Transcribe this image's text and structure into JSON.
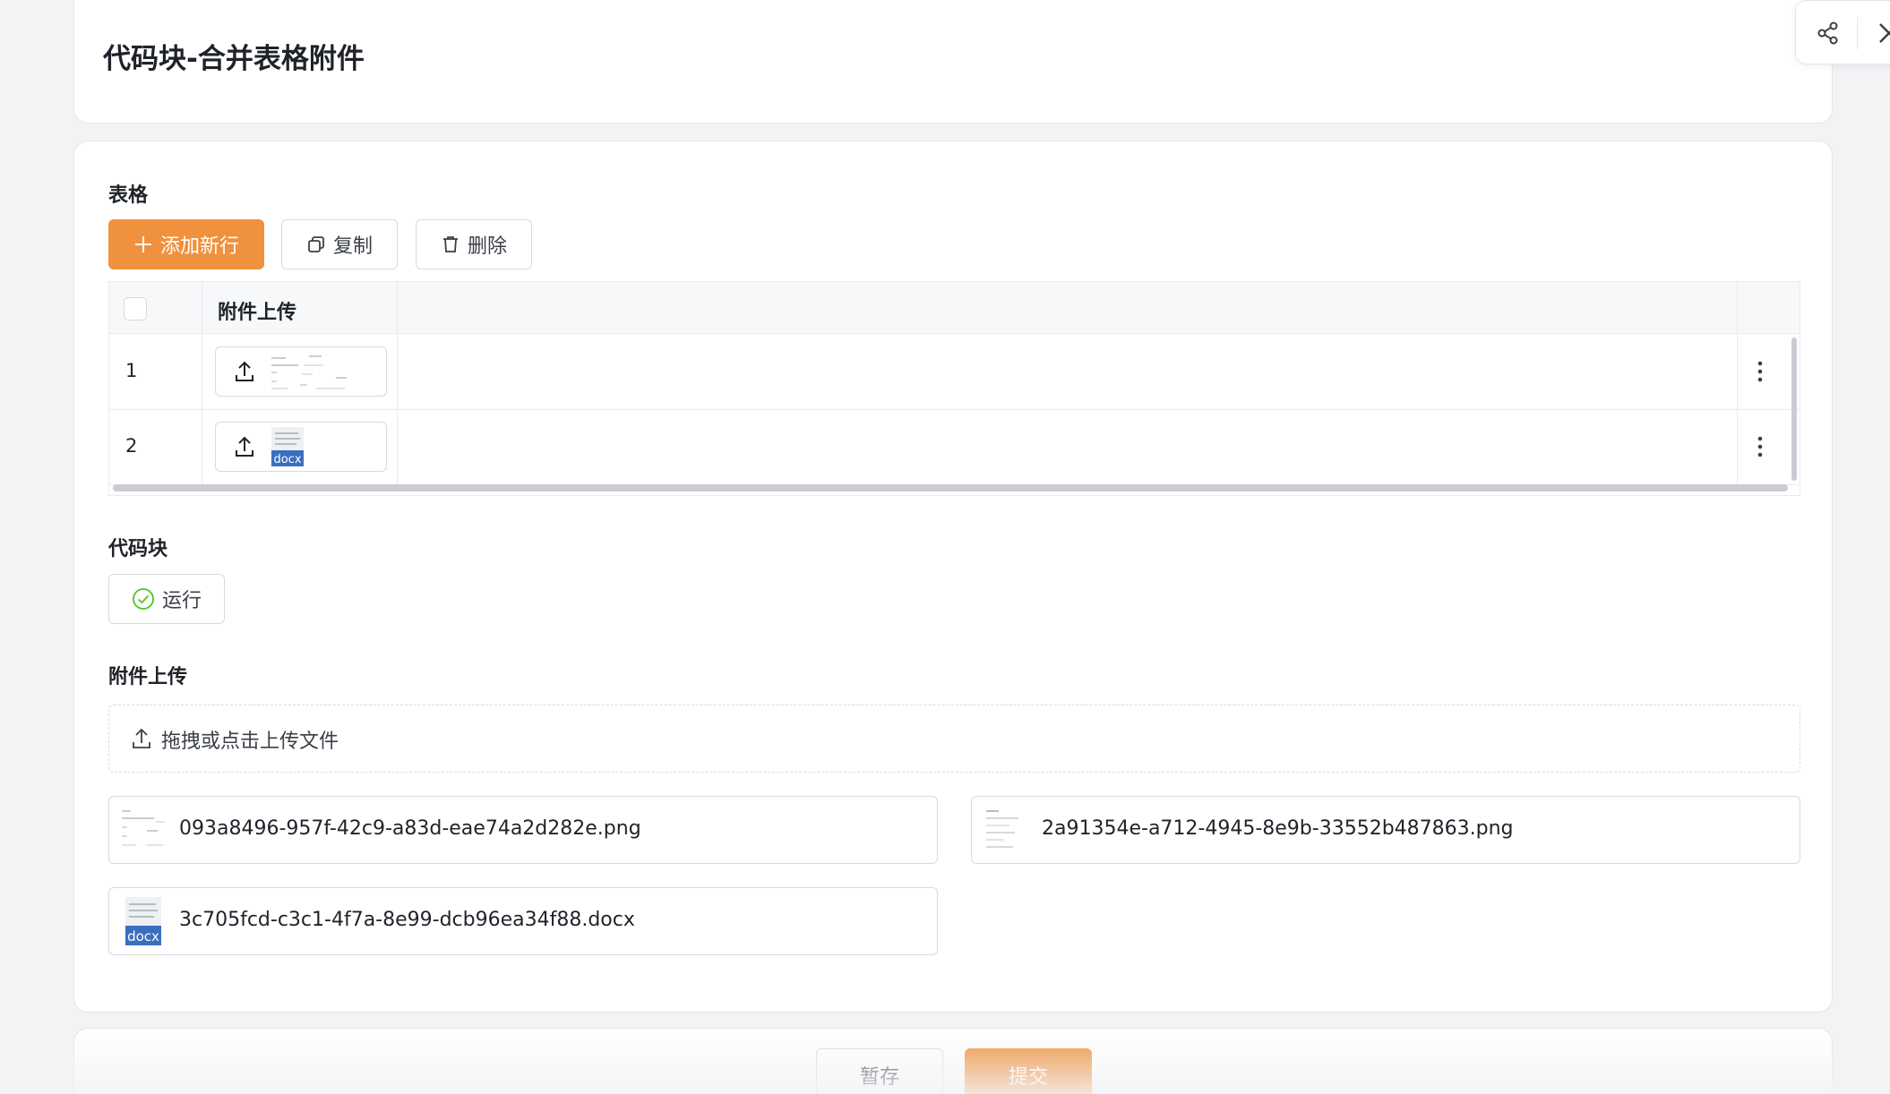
{
  "page": {
    "title": "代码块-合并表格附件"
  },
  "header_actions": {
    "share_icon": "share-icon",
    "close_icon": "close-icon"
  },
  "table_section": {
    "label": "表格",
    "add_row_label": "添加新行",
    "copy_label": "复制",
    "delete_label": "删除",
    "column_header": "附件上传",
    "rows": [
      {
        "index": "1",
        "attachment_type": "image"
      },
      {
        "index": "2",
        "attachment_type": "docx",
        "attachment_badge": "docx"
      }
    ]
  },
  "code_section": {
    "label": "代码块",
    "run_label": "运行"
  },
  "upload_section": {
    "label": "附件上传",
    "dropzone_text": "拖拽或点击上传文件",
    "files": [
      {
        "name": "093a8496-957f-42c9-a83d-eae74a2d282e.png",
        "type": "image"
      },
      {
        "name": "2a91354e-a712-4945-8e9b-33552b487863.png",
        "type": "image"
      },
      {
        "name": "3c705fcd-c3c1-4f7a-8e99-dcb96ea34f88.docx",
        "type": "docx",
        "badge": "docx"
      }
    ]
  },
  "footer": {
    "save_label": "暂存",
    "submit_label": "提交"
  },
  "colors": {
    "primary": "#f0913d",
    "run_check": "#52c41a",
    "docx_badge": "#3a6fbf"
  }
}
